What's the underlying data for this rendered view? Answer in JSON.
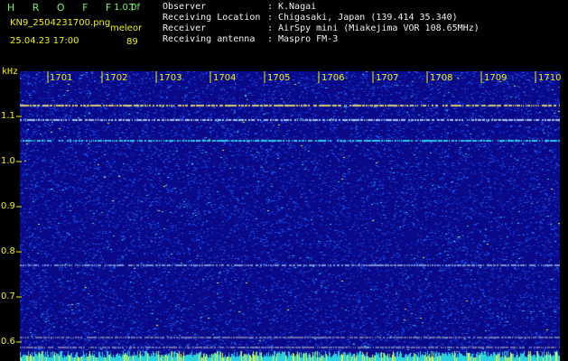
{
  "header": {
    "app_title": "H R O F F T",
    "version": "1.0.0f",
    "filename": "KN9_2504231700.png",
    "timestamp": "25.04.23 17:00",
    "source_label": "meleor",
    "count": "89"
  },
  "info": [
    {
      "key": "Observer",
      "value": "K.Nagai"
    },
    {
      "key": "Receiving Location",
      "value": "Chigasaki, Japan (139.414 35.340)"
    },
    {
      "key": "Receiver",
      "value": "AirSpy mini (Miakejima VOR 108.65MHz)"
    },
    {
      "key": "Receiving antenna",
      "value": "Maspro FM-3"
    }
  ],
  "separator": ":",
  "spectrogram": {
    "y_unit": "kHz",
    "y_ticks": [
      "1.1",
      "1.0",
      "0.9",
      "0.8",
      "0.7",
      "0.6"
    ],
    "x_ticks": [
      "1701",
      "1702",
      "1703",
      "1704",
      "1705",
      "1706",
      "1707",
      "1708",
      "1709",
      "1710"
    ],
    "colors": {
      "background": "#0a0a88",
      "noise": [
        "#1238d8",
        "#1e5ef0",
        "#0c1cb0",
        "#2ad2e0",
        "#e6f046"
      ],
      "axis_text": "#f2f200",
      "grid": "#c8c8c8"
    }
  }
}
